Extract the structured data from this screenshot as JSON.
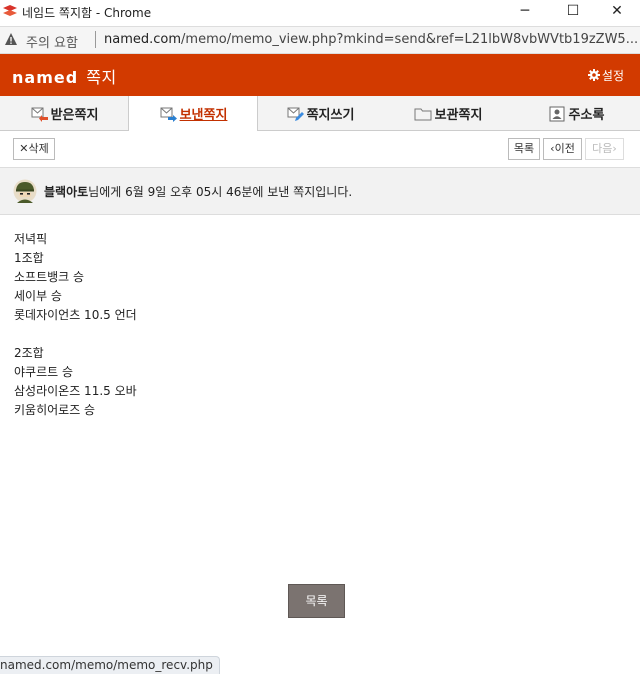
{
  "window": {
    "title": "네임드 쪽지함 - Chrome",
    "minimize_label": "─",
    "maximize_label": "☐",
    "close_label": "✕"
  },
  "address_bar": {
    "security_label": "주의 요함",
    "url_host": "named.com",
    "url_path": "/memo/memo_view.php?mkind=send&ref=L21lbW8vbWVtb19zZW5..."
  },
  "header": {
    "brand": "named",
    "brand_sub": "쪽지",
    "settings_label": "설정",
    "colors": {
      "brand_bg": "#d23a00"
    }
  },
  "tabs": [
    {
      "label": "받은쪽지",
      "icon": "inbox-mail-icon",
      "active": false
    },
    {
      "label": "보낸쪽지",
      "icon": "sent-mail-icon",
      "active": true
    },
    {
      "label": "쪽지쓰기",
      "icon": "compose-icon",
      "active": false
    },
    {
      "label": "보관쪽지",
      "icon": "folder-icon",
      "active": false
    },
    {
      "label": "주소록",
      "icon": "contacts-icon",
      "active": false
    }
  ],
  "toolbar": {
    "delete_label": "✕삭제",
    "list_label": "목록",
    "prev_label": "‹이전",
    "next_label": "다음›"
  },
  "message": {
    "recipient": "블랙아토",
    "meta": "님에게 6월 9일 오후 05시 46분에 보낸 쪽지입니다.",
    "lines": [
      "저녁픽",
      "1조합",
      "소프트뱅크 승",
      "세이부 승",
      "롯데자이언츠 10.5 언더",
      "",
      "2조합",
      "야쿠르트 승",
      "삼성라이온즈 11.5 오바",
      "키움히어로즈 승"
    ]
  },
  "footer": {
    "list_button": "목록"
  },
  "status_bar": {
    "url": "named.com/memo/memo_recv.php"
  }
}
